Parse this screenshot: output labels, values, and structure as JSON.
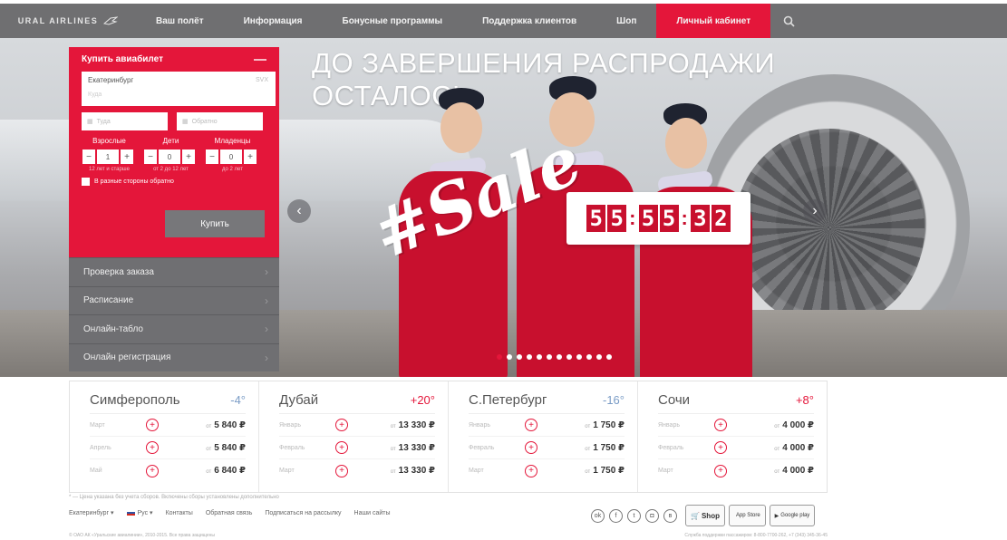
{
  "nav": {
    "logo_text": "URAL AIRLINES",
    "items": [
      {
        "label": "Ваш полёт"
      },
      {
        "label": "Информация"
      },
      {
        "label": "Бонусные программы"
      },
      {
        "label": "Поддержка клиентов"
      },
      {
        "label": "Шоп"
      },
      {
        "label": "Личный кабинет"
      }
    ]
  },
  "hero": {
    "headline_line1": "ДО ЗАВЕРШЕНИЯ РАСПРОДАЖИ",
    "headline_line2": "ОСТАЛОСЬ",
    "sale_text": "#Sale",
    "timer_digits": [
      "5",
      "5",
      "5",
      "5",
      "3",
      "2"
    ],
    "slide_count": 12,
    "active_slide": 0
  },
  "booking": {
    "title": "Купить авиабилет",
    "from_city": "Екатеринбург",
    "from_code": "SVX",
    "to_placeholder": "Куда",
    "depart_placeholder": "Туда",
    "return_placeholder": "Обратно",
    "adults_label": "Взрослые",
    "children_label": "Дети",
    "infants_label": "Младенцы",
    "adults_value": "1",
    "children_value": "0",
    "infants_value": "0",
    "adults_note": "12 лет и старше",
    "children_note": "от 2 до 12 лет",
    "infants_note": "до 2 лет",
    "roundtrip_label": "В разные стороны обратно",
    "buy_label": "Купить"
  },
  "side_menu": [
    {
      "label": "Проверка заказа"
    },
    {
      "label": "Расписание"
    },
    {
      "label": "Онлайн-табло"
    },
    {
      "label": "Онлайн регистрация"
    }
  ],
  "deals": [
    {
      "city": "Симферополь",
      "temp": "-4°",
      "temp_type": "cold",
      "rows": [
        {
          "month": "Март",
          "from": "от",
          "price": "5 840 ₽"
        },
        {
          "month": "Апрель",
          "from": "от",
          "price": "5 840 ₽"
        },
        {
          "month": "Май",
          "from": "от",
          "price": "6 840 ₽"
        }
      ]
    },
    {
      "city": "Дубай",
      "temp": "+20°",
      "temp_type": "warm",
      "rows": [
        {
          "month": "Январь",
          "from": "от",
          "price": "13 330 ₽"
        },
        {
          "month": "Февраль",
          "from": "от",
          "price": "13 330 ₽"
        },
        {
          "month": "Март",
          "from": "от",
          "price": "13 330 ₽"
        }
      ]
    },
    {
      "city": "С.Петербург",
      "temp": "-16°",
      "temp_type": "cold",
      "rows": [
        {
          "month": "Январь",
          "from": "от",
          "price": "1 750 ₽"
        },
        {
          "month": "Февраль",
          "from": "от",
          "price": "1 750 ₽"
        },
        {
          "month": "Март",
          "from": "от",
          "price": "1 750 ₽"
        }
      ]
    },
    {
      "city": "Сочи",
      "temp": "+8°",
      "temp_type": "warm",
      "rows": [
        {
          "month": "Январь",
          "from": "от",
          "price": "4 000 ₽"
        },
        {
          "month": "Февраль",
          "from": "от",
          "price": "4 000 ₽"
        },
        {
          "month": "Март",
          "from": "от",
          "price": "4 000 ₽"
        }
      ]
    }
  ],
  "footer": {
    "footnote": "* — Цена указана без учета сборов. Включены сборы установлены дополнительно",
    "city": "Екатеринбург ▾",
    "lang": "Рус ▾",
    "links": [
      "Контакты",
      "Обратная связь",
      "Подписаться на рассылку",
      "Наши сайты"
    ],
    "store_shop": "Shop",
    "store_appstore": "App Store",
    "store_gplay": "Google play",
    "copyright": "© ОАО АК «Уральские авиалинии», 2010-2015. Все права защищены",
    "contact": "Служба поддержки пассажиров: 8-800-7700-262, +7 (343) 345-36-45"
  },
  "colors": {
    "brand_red": "#e4163a",
    "nav_gray": "#6f6f71"
  }
}
